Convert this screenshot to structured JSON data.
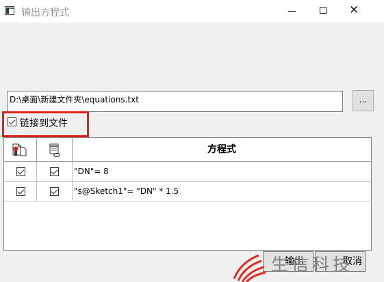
{
  "window": {
    "title": "输出方程式",
    "close_glyph": "✕"
  },
  "file": {
    "path": "D:\\桌面\\新建文件夹\\equations.txt",
    "browse_label": "..."
  },
  "link_option": {
    "label": "链接到文件",
    "checked": true
  },
  "table": {
    "header_icons": [
      "include-part-icon",
      "calendar-link-icon"
    ],
    "equation_header": "方程式",
    "rows": [
      {
        "col1_checked": true,
        "col2_checked": true,
        "equation": "\"DN\"= 8"
      },
      {
        "col1_checked": true,
        "col2_checked": true,
        "equation": "\"s@Sketch1\"= \"DN\" * 1.5"
      }
    ]
  },
  "buttons": {
    "ok": "输出",
    "cancel": "取消"
  },
  "watermark": {
    "text": "生信科技"
  },
  "colors": {
    "highlight": "#e0201b",
    "watermark_logo": "#e02a22",
    "watermark_text": "#7f7f7f"
  }
}
